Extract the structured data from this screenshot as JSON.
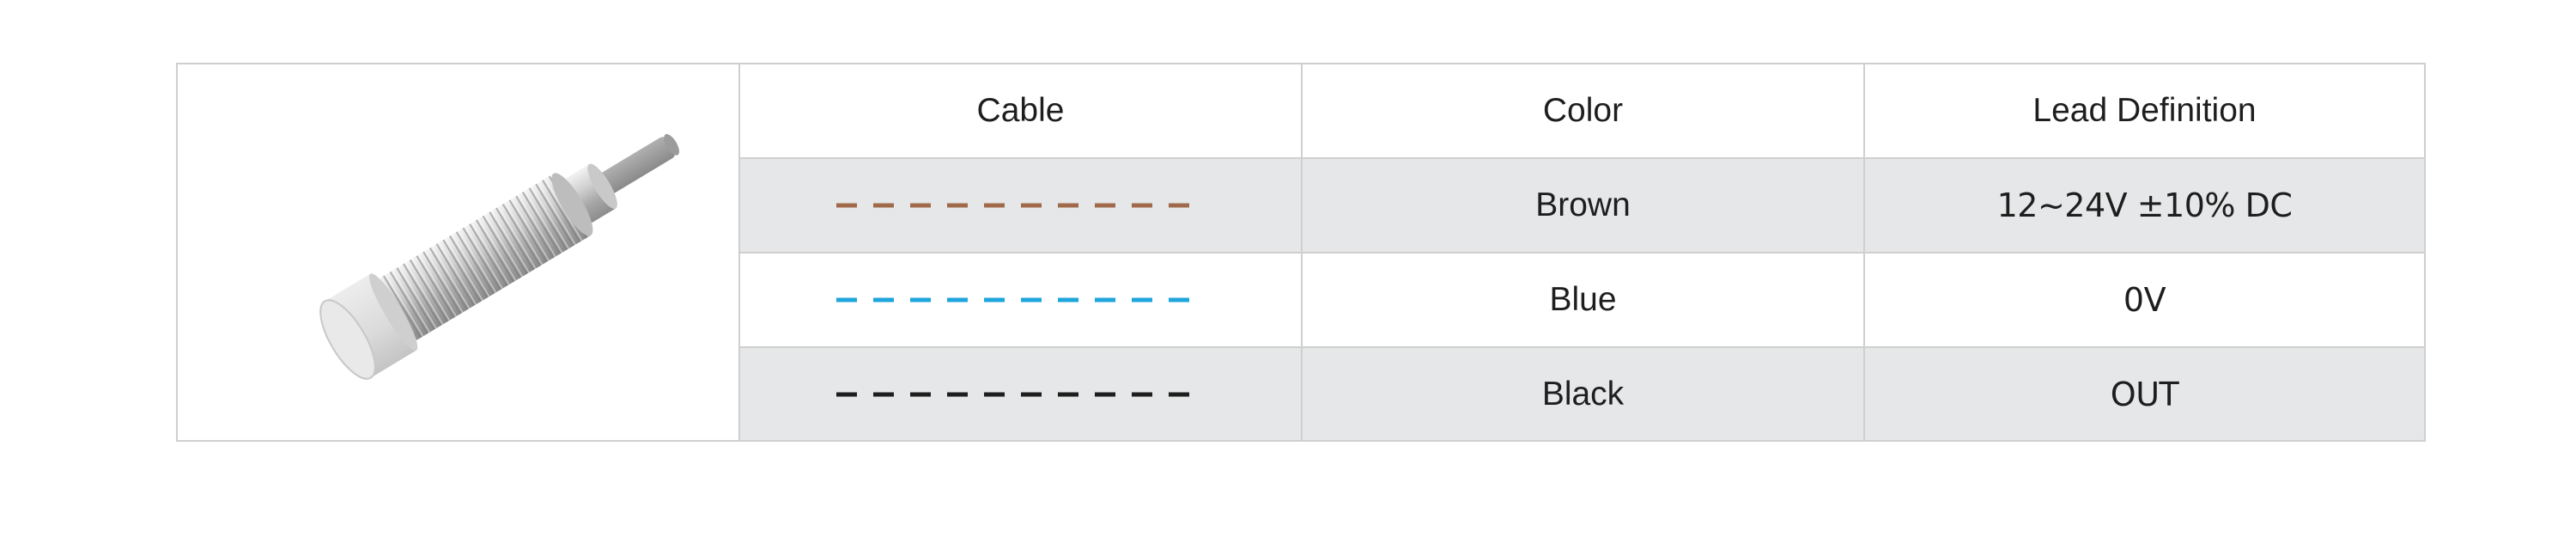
{
  "table": {
    "headers": {
      "cable": "Cable",
      "color": "Color",
      "lead": "Lead Definition"
    },
    "rows": [
      {
        "color_name": "Brown",
        "lead_definition": "12~24V ±10% DC",
        "cable_color": "#a0694a"
      },
      {
        "color_name": "Blue",
        "lead_definition": "0V",
        "cable_color": "#1ea6dc"
      },
      {
        "color_name": "Black",
        "lead_definition": "OUT",
        "cable_color": "#1e1e1e"
      }
    ]
  },
  "image": {
    "icon": "cylindrical-proximity-sensor-icon"
  },
  "colors": {
    "grid_border": "#cfcfcf",
    "alt_row_bg": "#e6e7e8"
  }
}
